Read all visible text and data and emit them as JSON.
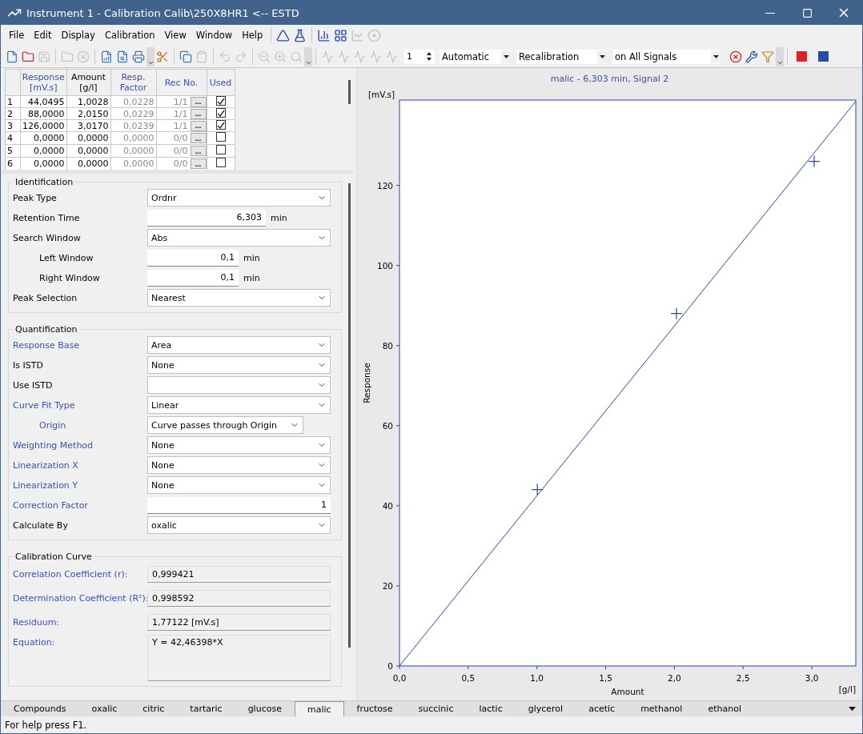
{
  "window": {
    "title": "Instrument 1 - Calibration Calib\\250X8HR1 <-- ESTD"
  },
  "menu": [
    "File",
    "Edit",
    "Display",
    "Calibration",
    "View",
    "Window",
    "Help"
  ],
  "menu_tools": [
    {
      "disabled": false
    },
    {
      "disabled": false
    },
    {
      "disabled": false
    },
    {
      "disabled": false
    },
    {
      "disabled": true
    },
    {
      "disabled": true
    }
  ],
  "toolbar": {
    "buttons": [
      {
        "disabled": false
      },
      {
        "disabled": false
      },
      {
        "disabled": true
      },
      {
        "disabled": true
      },
      {
        "disabled": true
      },
      {
        "disabled": false
      },
      {
        "disabled": false
      },
      {
        "disabled": false
      },
      {
        "disabled": false
      },
      {
        "disabled": false
      },
      {
        "disabled": true
      },
      {
        "disabled": true
      },
      {
        "disabled": true
      },
      {
        "disabled": true
      },
      {
        "disabled": true
      },
      {
        "disabled": true
      },
      {
        "disabled": true
      },
      {
        "disabled": true
      },
      {
        "disabled": true
      },
      {
        "disabled": true
      },
      {
        "disabled": true
      }
    ],
    "spinner": "1",
    "selects": [
      "Automatic",
      "Recalibration",
      "on All Signals"
    ],
    "right_buttons": [
      {
        "disabled": false
      },
      {
        "disabled": false
      },
      {
        "disabled": false
      }
    ],
    "color_buttons": [
      {
        "color": "#e81c24"
      },
      {
        "color": "#2a4ca8"
      }
    ]
  },
  "table": {
    "columns": [
      "Response\n[mV.s]",
      "Amount\n[g/l]",
      "Resp.\nFactor",
      "Rec No.",
      "Used"
    ],
    "rows": [
      {
        "index": "1",
        "response": "44,0495",
        "amount": "1,0028",
        "factor": "0,0228",
        "rec_no": "1/1",
        "used": true
      },
      {
        "index": "2",
        "response": "88,0000",
        "amount": "2,0150",
        "factor": "0,0229",
        "rec_no": "1/1",
        "used": true
      },
      {
        "index": "3",
        "response": "126,0000",
        "amount": "3,0170",
        "factor": "0,0239",
        "rec_no": "1/1",
        "used": true
      },
      {
        "index": "4",
        "response": "0,0000",
        "amount": "0,0000",
        "factor": "0,0000",
        "rec_no": "0/0",
        "used": false
      },
      {
        "index": "5",
        "response": "0,0000",
        "amount": "0,0000",
        "factor": "0,0000",
        "rec_no": "0/0",
        "used": false
      },
      {
        "index": "6",
        "response": "0,0000",
        "amount": "0,0000",
        "factor": "0,0000",
        "rec_no": "0/0",
        "used": false
      }
    ],
    "row_button": "..."
  },
  "groups": [
    {
      "title": "Identification",
      "fields": [
        {
          "label": "Peak Type",
          "kind": "dropdown",
          "value": "Ordnr",
          "highlighted": false,
          "indented": false
        },
        {
          "label": "Retention Time",
          "kind": "number",
          "value": "6,303",
          "unit": "min",
          "highlighted": false,
          "indented": false
        },
        {
          "label": "Search Window",
          "kind": "dropdown",
          "value": "Abs",
          "highlighted": false,
          "indented": false
        },
        {
          "label": "Left Window",
          "kind": "number",
          "value": "0,1",
          "unit": "min",
          "highlighted": false,
          "indented": true
        },
        {
          "label": "Right Window",
          "kind": "number",
          "value": "0,1",
          "unit": "min",
          "highlighted": false,
          "indented": true
        },
        {
          "label": "Peak Selection",
          "kind": "dropdown",
          "value": "Nearest",
          "highlighted": false,
          "indented": false
        }
      ]
    },
    {
      "title": "Quantification",
      "fields": [
        {
          "label": "Response Base",
          "kind": "dropdown",
          "value": "Area",
          "highlighted": true,
          "indented": false
        },
        {
          "label": "Is ISTD",
          "kind": "dropdown",
          "value": "None",
          "highlighted": false,
          "indented": false
        },
        {
          "label": "Use ISTD",
          "kind": "dropdown",
          "highlighted": false,
          "indented": false
        },
        {
          "label": "Curve Fit Type",
          "kind": "dropdown",
          "value": "Linear",
          "highlighted": true,
          "indented": false
        },
        {
          "label": "Origin",
          "kind": "dropdown",
          "value": "Curve passes through Origin",
          "highlighted": true,
          "indented": true
        },
        {
          "label": "Weighting Method",
          "kind": "dropdown",
          "value": "None",
          "highlighted": true,
          "indented": false
        },
        {
          "label": "Linearization X",
          "kind": "dropdown",
          "value": "None",
          "highlighted": true,
          "indented": false
        },
        {
          "label": "Linearization Y",
          "kind": "dropdown",
          "value": "None",
          "highlighted": true,
          "indented": false
        },
        {
          "label": "Correction Factor",
          "kind": "number",
          "value": "1",
          "highlighted": true,
          "indented": false
        },
        {
          "label": "Calculate By",
          "kind": "dropdown",
          "value": "oxalic",
          "highlighted": false,
          "indented": false
        }
      ]
    },
    {
      "title": "Calibration Curve",
      "fields": [
        {
          "label": "Correlation Coefficient (r):",
          "kind": "readonly",
          "value": "0,999421",
          "highlighted": true,
          "indented": false
        },
        {
          "label": "Determination Coefficient (R²):",
          "kind": "readonly",
          "value": "0,998592",
          "highlighted": true,
          "indented": false
        },
        {
          "label": "Residuum:",
          "kind": "readonly",
          "value": "1,77122 [mV.s]",
          "highlighted": true,
          "indented": false
        },
        {
          "label": "Equation:",
          "kind": "memo",
          "value": "Y = 42,46398*X",
          "highlighted": true,
          "indented": false
        }
      ]
    }
  ],
  "chart": {
    "y_unit": "[mV.s]",
    "x_unit": "[g/l]",
    "chart_data": {
      "type": "line",
      "title": "malic - 6,303 min, Signal 2",
      "xlabel": "Amount",
      "ylabel": "Response",
      "x": [
        0,
        1,
        2,
        3,
        3.32
      ],
      "series": [
        {
          "color": "#2a44a8",
          "values": [
            0,
            42.5,
            84.9,
            127.4,
            141
          ]
        }
      ],
      "xlim": [
        0,
        3.32
      ],
      "ylim": [
        0,
        141.3
      ],
      "xticks": [
        {
          "value": 0,
          "label": "0,0"
        },
        {
          "value": 0.5,
          "label": "0,5"
        },
        {
          "value": 1,
          "label": "1,0"
        },
        {
          "value": 1.5,
          "label": "1,5"
        },
        {
          "value": 2,
          "label": "2,0"
        },
        {
          "value": 2.5,
          "label": "2,5"
        },
        {
          "value": 3,
          "label": "3,0"
        }
      ],
      "yticks": [
        0,
        20,
        40,
        60,
        80,
        100,
        120
      ]
    }
  },
  "tabs": [
    {
      "label": "Compounds",
      "selected": false
    },
    {
      "label": "oxalic",
      "selected": false
    },
    {
      "label": "citric",
      "selected": false
    },
    {
      "label": "tartaric",
      "selected": false
    },
    {
      "label": "glucose",
      "selected": false
    },
    {
      "label": "malic",
      "selected": true
    },
    {
      "label": "fructose",
      "selected": false
    },
    {
      "label": "succinic",
      "selected": false
    },
    {
      "label": "lactic",
      "selected": false
    },
    {
      "label": "glycerol",
      "selected": false
    },
    {
      "label": "acetic",
      "selected": false
    },
    {
      "label": "methanol",
      "selected": false
    },
    {
      "label": "ethanol",
      "selected": false
    }
  ],
  "status_bar": "For help press F1."
}
